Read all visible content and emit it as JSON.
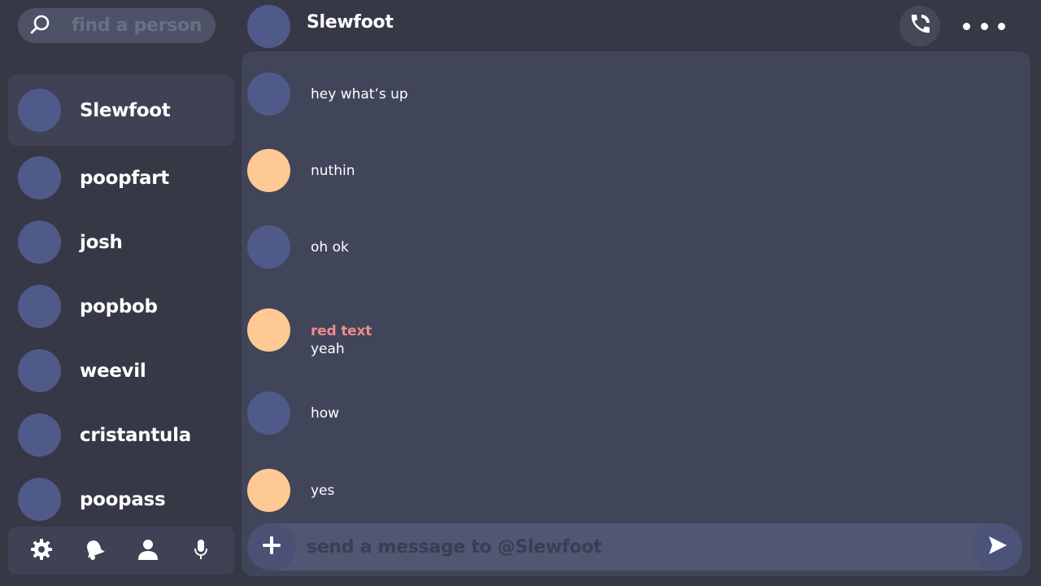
{
  "colors": {
    "app_background": "#363845",
    "chat_panel": "#40455a",
    "avatar_blue": "#505a8a",
    "avatar_peach": "#ffc994",
    "sender_red": "#f08a8a"
  },
  "search": {
    "placeholder": "find a person",
    "icon": "search-icon"
  },
  "contacts": [
    {
      "name": "Slewfoot",
      "active": true
    },
    {
      "name": "poopfart",
      "active": false
    },
    {
      "name": "josh",
      "active": false
    },
    {
      "name": "popbob",
      "active": false
    },
    {
      "name": "weevil",
      "active": false
    },
    {
      "name": "cristantula",
      "active": false
    },
    {
      "name": "poopass",
      "active": false
    }
  ],
  "bottom_bar": {
    "icons": [
      "gear-icon",
      "notification-bell-icon",
      "profile-icon",
      "microphone-icon"
    ]
  },
  "header": {
    "title": "Slewfoot",
    "call_icon": "phone-call-icon",
    "more_icon": "more-dots-icon"
  },
  "messages": [
    {
      "avatar": "blue",
      "sender": "",
      "text": "hey what’s up"
    },
    {
      "avatar": "peach",
      "sender": "",
      "text": "nuthin"
    },
    {
      "avatar": "blue",
      "sender": "",
      "text": "oh ok"
    },
    {
      "avatar": "peach",
      "sender": "red text",
      "text": "yeah"
    },
    {
      "avatar": "blue",
      "sender": "",
      "text": "how"
    },
    {
      "avatar": "peach",
      "sender": "",
      "text": "yes"
    }
  ],
  "composer": {
    "placeholder": "send a message to @Slewfoot",
    "attach_icon": "plus-icon",
    "send_icon": "send-arrow-icon"
  }
}
